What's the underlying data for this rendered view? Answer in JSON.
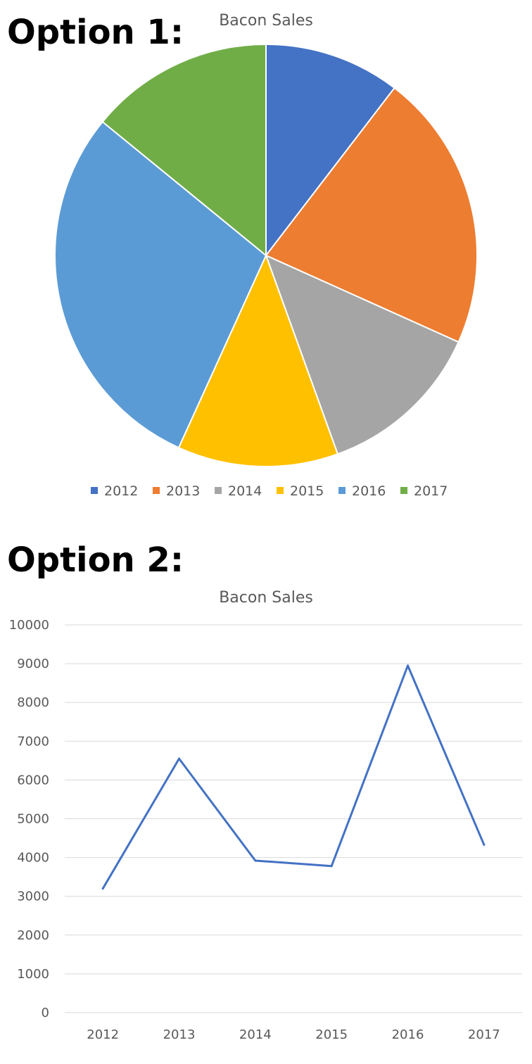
{
  "headings": {
    "option1": "Option 1:",
    "option2": "Option 2:"
  },
  "colors": {
    "text": "#595959",
    "gridline": "#d9d9d9",
    "line_series": "#4472c4"
  },
  "chart_data": [
    {
      "type": "pie",
      "title": "Bacon Sales",
      "categories": [
        "2012",
        "2013",
        "2014",
        "2015",
        "2016",
        "2017"
      ],
      "values": [
        3200,
        6550,
        3920,
        3780,
        8950,
        4330
      ],
      "colors": [
        "#4472c4",
        "#ed7d31",
        "#a5a5a5",
        "#ffc000",
        "#5b9bd5",
        "#70ad47"
      ],
      "legend_position": "bottom"
    },
    {
      "type": "line",
      "title": "Bacon Sales",
      "categories": [
        "2012",
        "2013",
        "2014",
        "2015",
        "2016",
        "2017"
      ],
      "series": [
        {
          "values": [
            3200,
            6550,
            3920,
            3780,
            8950,
            4330
          ]
        }
      ],
      "ylim": [
        0,
        10000
      ],
      "yticks": [
        "0",
        "1000",
        "2000",
        "3000",
        "4000",
        "5000",
        "6000",
        "7000",
        "8000",
        "9000",
        "10000"
      ],
      "grid": true,
      "legend": false
    }
  ]
}
